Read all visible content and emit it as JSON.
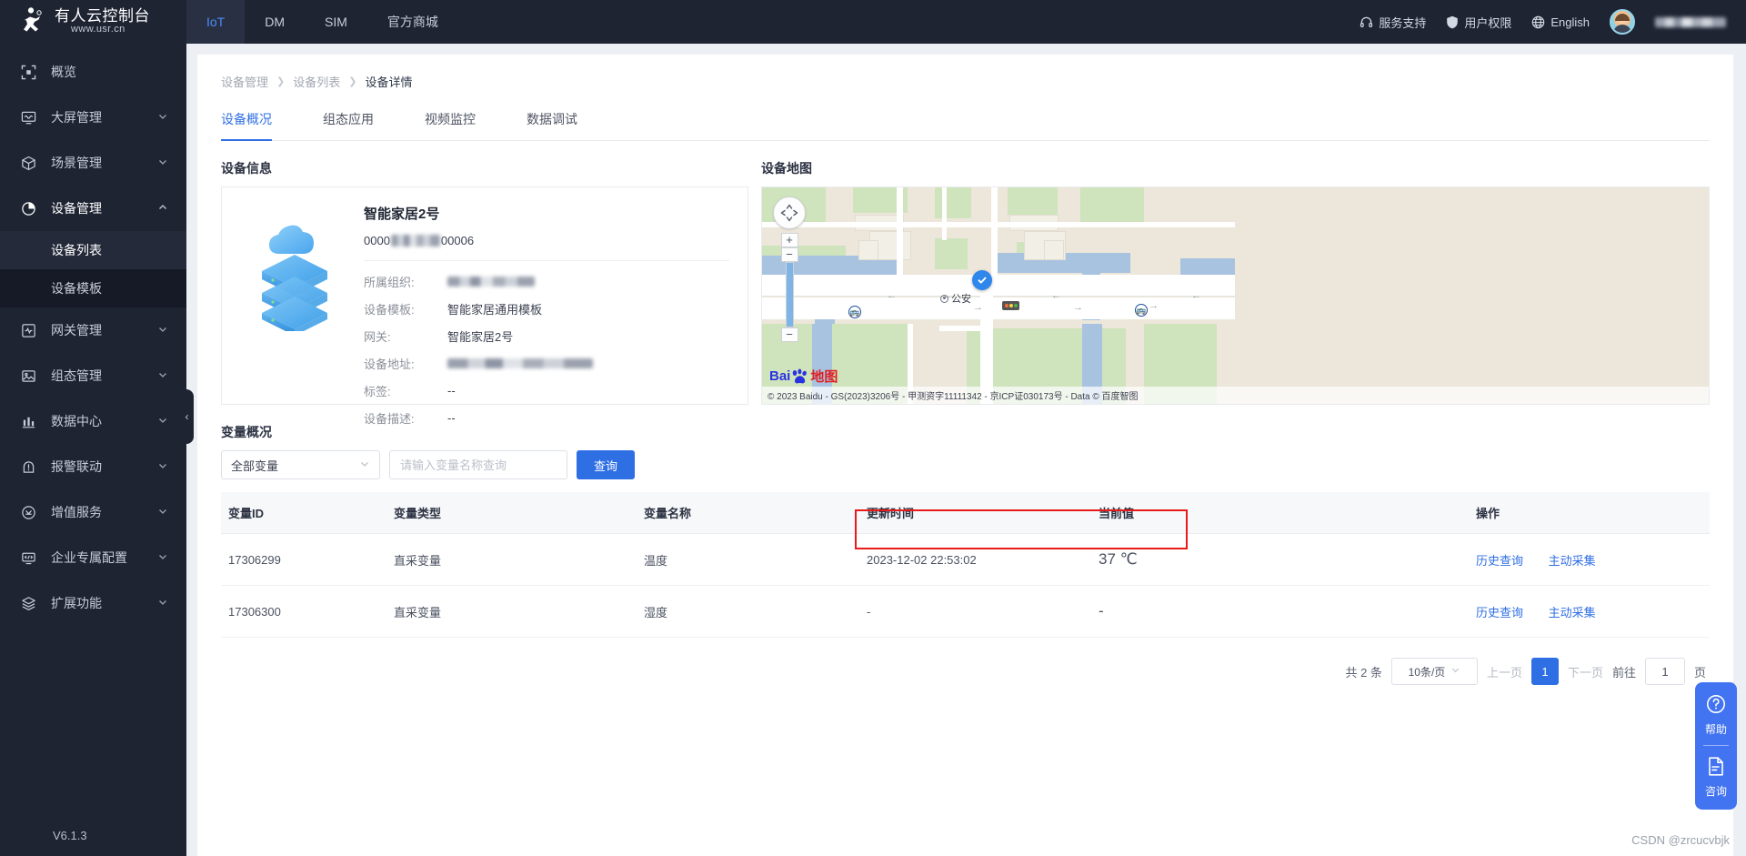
{
  "header": {
    "brand_title": "有人云控制台",
    "brand_sub": "www.usr.cn",
    "nav": [
      {
        "label": "IoT",
        "active": true
      },
      {
        "label": "DM",
        "active": false
      },
      {
        "label": "SIM",
        "active": false
      },
      {
        "label": "官方商城",
        "active": false
      }
    ],
    "right": [
      {
        "label": "服务支持",
        "icon": "headset-icon"
      },
      {
        "label": "用户权限",
        "icon": "shield-icon"
      },
      {
        "label": "English",
        "icon": "globe-icon"
      }
    ],
    "username_masked": "████████"
  },
  "sidebar": {
    "items": [
      {
        "label": "概览",
        "icon": "overview-icon",
        "has_arrow": false
      },
      {
        "label": "大屏管理",
        "icon": "screen-icon",
        "has_arrow": true
      },
      {
        "label": "场景管理",
        "icon": "cube-icon",
        "has_arrow": true
      },
      {
        "label": "设备管理",
        "icon": "pie-icon",
        "has_arrow": true,
        "expanded": true
      },
      {
        "label": "网关管理",
        "icon": "gateway-icon",
        "has_arrow": true
      },
      {
        "label": "组态管理",
        "icon": "image-icon",
        "has_arrow": true
      },
      {
        "label": "数据中心",
        "icon": "bar-chart-icon",
        "has_arrow": true
      },
      {
        "label": "报警联动",
        "icon": "alarm-icon",
        "has_arrow": true
      },
      {
        "label": "增值服务",
        "icon": "value-add-icon",
        "has_arrow": true
      },
      {
        "label": "企业专属配置",
        "icon": "code-screen-icon",
        "has_arrow": true
      },
      {
        "label": "扩展功能",
        "icon": "layers-icon",
        "has_arrow": true
      }
    ],
    "submenu": [
      {
        "label": "设备列表",
        "active": true
      },
      {
        "label": "设备模板",
        "active": false
      }
    ],
    "version": "V6.1.3"
  },
  "breadcrumb": [
    {
      "label": "设备管理"
    },
    {
      "label": "设备列表"
    },
    {
      "label": "设备详情"
    }
  ],
  "tabs": [
    {
      "label": "设备概况",
      "active": true
    },
    {
      "label": "组态应用",
      "active": false
    },
    {
      "label": "视频监控",
      "active": false
    },
    {
      "label": "数据调试",
      "active": false
    }
  ],
  "device_info": {
    "section_title": "设备信息",
    "name": "智能家居2号",
    "sn_prefix": "0000",
    "sn_suffix": "00006",
    "fields": [
      {
        "key": "所属组织:",
        "value": "",
        "masked": true,
        "mask_width": 96
      },
      {
        "key": "设备模板:",
        "value": "智能家居通用模板",
        "masked": false
      },
      {
        "key": "网关:",
        "value": "智能家居2号",
        "masked": false
      },
      {
        "key": "设备地址:",
        "value": "",
        "masked": true,
        "mask_width": 160
      },
      {
        "key": "标签:",
        "value": "--",
        "masked": false
      },
      {
        "key": "设备描述:",
        "value": "--",
        "masked": false
      }
    ]
  },
  "map": {
    "section_title": "设备地图",
    "poi_label": "公安",
    "logo_bai": "Bai",
    "logo_map": "地图",
    "copyright": "© 2023 Baidu - GS(2023)3206号 - 甲测资字11111342 - 京ICP证030173号 - Data © 百度智图",
    "zoom_in": "+",
    "zoom_out": "−"
  },
  "variables": {
    "section_title": "变量概况",
    "filter_select_value": "全部变量",
    "search_placeholder": "请输入变量名称查询",
    "search_value": "",
    "query_button": "查询",
    "columns": [
      "变量ID",
      "变量类型",
      "变量名称",
      "更新时间",
      "当前值",
      "操作"
    ],
    "rows": [
      {
        "id": "17306299",
        "type": "直采变量",
        "name": "温度",
        "updated": "2023-12-02 22:53:02",
        "value": "37 ℃",
        "actions": [
          "历史查询",
          "主动采集"
        ]
      },
      {
        "id": "17306300",
        "type": "直采变量",
        "name": "湿度",
        "updated": "-",
        "value": "-",
        "actions": [
          "历史查询",
          "主动采集"
        ]
      }
    ]
  },
  "pagination": {
    "total_text": "共 2 条",
    "page_size": "10条/页",
    "prev": "上一页",
    "current_page": "1",
    "next": "下一页",
    "jump_prefix": "前往",
    "jump_value": "1",
    "jump_suffix": "页"
  },
  "float_help": {
    "help_label": "帮助",
    "consult_label": "咨询"
  },
  "watermark": "CSDN @zrcucvbjk",
  "colors": {
    "accent": "#2f6fe4",
    "sidebar_bg": "#1f2433",
    "annotation_red": "#e81a1a"
  }
}
